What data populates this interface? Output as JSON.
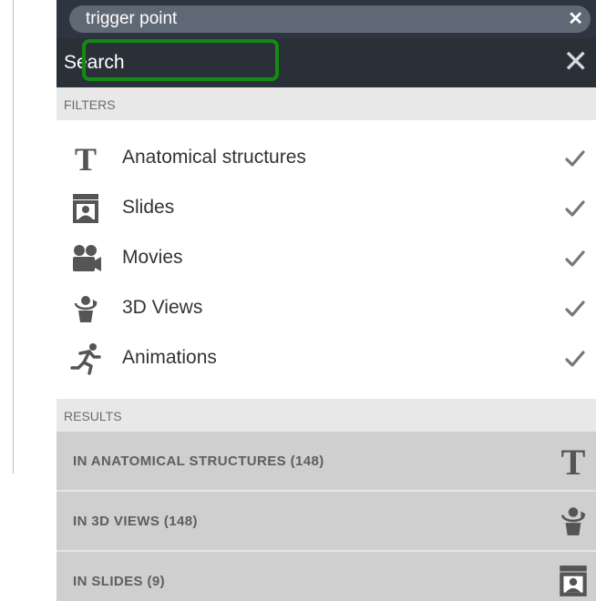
{
  "search": {
    "query": "trigger point",
    "clear_label": "✕",
    "title": "Search",
    "close_label": "✕"
  },
  "filters": {
    "heading": "FILTERS",
    "items": [
      {
        "label": "Anatomical structures",
        "icon": "text-t-icon",
        "checked": true
      },
      {
        "label": "Slides",
        "icon": "slide-icon",
        "checked": true
      },
      {
        "label": "Movies",
        "icon": "movie-camera-icon",
        "checked": true
      },
      {
        "label": "3D Views",
        "icon": "rotate-3d-icon",
        "checked": true
      },
      {
        "label": "Animations",
        "icon": "running-figure-icon",
        "checked": true
      }
    ]
  },
  "results": {
    "heading": "RESULTS",
    "items": [
      {
        "label": "IN ANATOMICAL STRUCTURES (148)",
        "icon": "text-t-icon"
      },
      {
        "label": "IN 3D VIEWS (148)",
        "icon": "rotate-3d-icon"
      },
      {
        "label": "IN SLIDES (9)",
        "icon": "slide-icon"
      }
    ]
  },
  "colors": {
    "header_dark": "#2a3038",
    "query_pill": "#5f6875",
    "highlight_green": "#138b13",
    "section_bg": "#e8e8e8",
    "result_bg": "#cfcfcf",
    "icon_gray": "#555555"
  }
}
